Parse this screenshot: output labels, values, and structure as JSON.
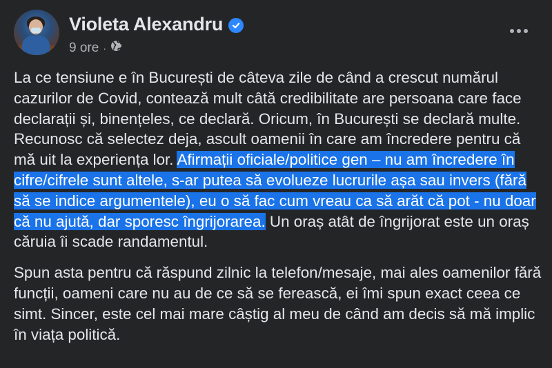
{
  "author": {
    "name": "Violeta Alexandru",
    "verified": true
  },
  "meta": {
    "time": "9 ore",
    "separator": "·",
    "audience_icon": "globe-icon"
  },
  "menu_icon": "more-horizontal-icon",
  "colors": {
    "background": "#242526",
    "text": "#e4e6eb",
    "secondary_text": "#b0b3b8",
    "verified_badge": "#2d88ff",
    "selection_highlight": "#1a73e8"
  },
  "post": {
    "paragraph1": {
      "before": "La ce tensiune e în București de câteva zile de când a crescut numărul cazurilor de Covid, contează mult câtă credibilitate are persoana care face declarații și, binențeles, ce declară. Oricum, în București se declară multe. Recunosc că selectez deja, ascult oamenii în care am încredere pentru că mă uit la experiența lor. ",
      "highlighted": "Afirmații oficiale/politice gen – nu am încredere în cifre/cifrele sunt altele, s-ar putea să evolueze lucrurile așa sau invers (fără să se indice argumentele), eu o să fac cum vreau ca să arăt că pot - nu doar că nu ajută, dar sporesc îngrijorarea.",
      "after": " Un oraș atât de îngrijorat este un oraș căruia îi scade randamentul."
    },
    "paragraph2": "Spun asta pentru că răspund zilnic la telefon/mesaje, mai ales oamenilor fără funcții, oameni care nu au de ce să se ferească, ei îmi spun exact ceea ce simt. Sincer, este cel mai mare câștig al meu de când am decis să mă implic în viața politică."
  }
}
